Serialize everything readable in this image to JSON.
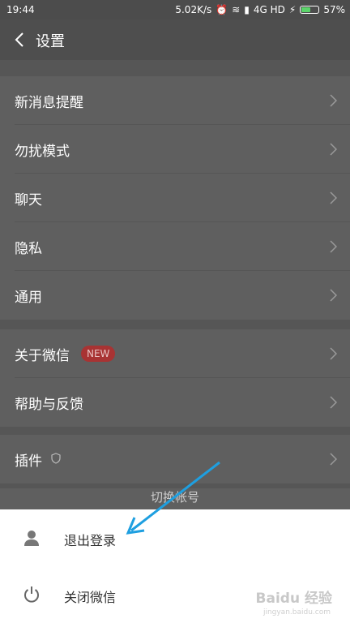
{
  "status_bar": {
    "time": "19:44",
    "speed": "5.02K/s",
    "network": "4G HD",
    "battery": "57%",
    "battery_level": 0.57
  },
  "header": {
    "title": "设置"
  },
  "settings": {
    "group1": [
      {
        "label": "新消息提醒"
      },
      {
        "label": "勿扰模式"
      },
      {
        "label": "聊天"
      },
      {
        "label": "隐私"
      },
      {
        "label": "通用"
      }
    ],
    "group2": [
      {
        "label": "关于微信",
        "badge": "NEW"
      },
      {
        "label": "帮助与反馈"
      }
    ],
    "group3": [
      {
        "label": "插件"
      }
    ]
  },
  "partially_hidden_text": "切换帐号",
  "action_sheet": {
    "items": [
      {
        "label": "退出登录",
        "icon": "person-icon"
      },
      {
        "label": "关闭微信",
        "icon": "power-icon"
      }
    ]
  },
  "watermark": {
    "main": "Baidu 经验",
    "sub": "jingyan.baidu.com"
  },
  "colors": {
    "overlay": "#5f5f5f",
    "badge": "#a83333",
    "arrow": "#1e9fe0",
    "battery_fill": "#5bd46a"
  }
}
